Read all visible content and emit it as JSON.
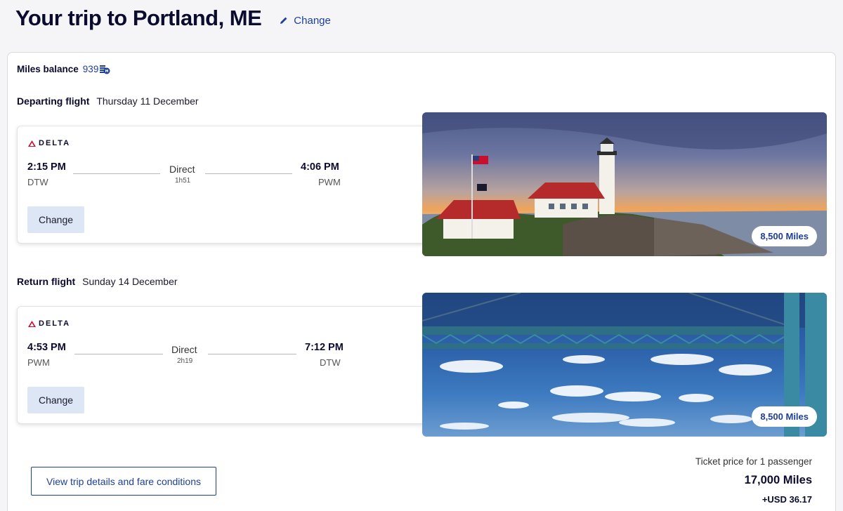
{
  "header": {
    "title": "Your trip to Portland, ME",
    "change_label": "Change"
  },
  "miles_balance": {
    "label": "Miles balance",
    "value": "939"
  },
  "departing": {
    "label": "Departing flight",
    "date": "Thursday 11 December",
    "airline": "DELTA",
    "depart_time": "2:15 PM",
    "depart_code": "DTW",
    "stops": "Direct",
    "duration": "1h51",
    "arrive_time": "4:06 PM",
    "arrive_code": "PWM",
    "change_label": "Change",
    "miles": "8,500 Miles"
  },
  "return": {
    "label": "Return flight",
    "date": "Sunday 14 December",
    "airline": "DELTA",
    "depart_time": "4:53 PM",
    "depart_code": "PWM",
    "stops": "Direct",
    "duration": "2h19",
    "arrive_time": "7:12 PM",
    "arrive_code": "DTW",
    "change_label": "Change",
    "miles": "8,500 Miles"
  },
  "footer": {
    "trip_details_label": "View trip details and fare conditions",
    "price_label": "Ticket price for 1 passenger",
    "price_miles": "17,000 Miles",
    "price_usd": "+USD 36.17"
  },
  "colors": {
    "brand_blue": "#1d3f9c",
    "delta_red": "#c8102e",
    "button_bg": "#dde6f5"
  }
}
